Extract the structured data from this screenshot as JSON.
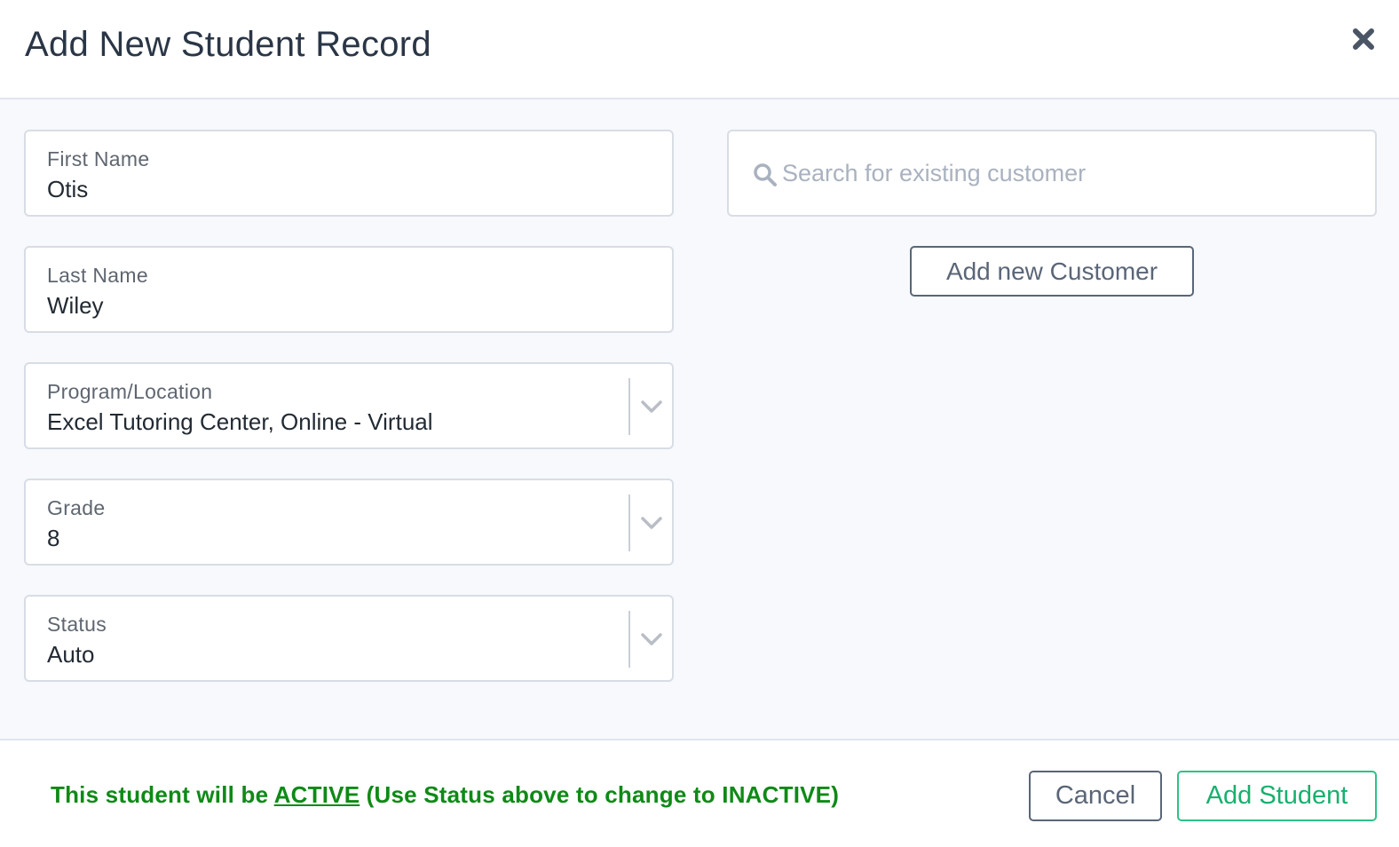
{
  "modal": {
    "title": "Add New Student Record",
    "close_icon": "close-icon"
  },
  "form": {
    "first_name": {
      "label": "First Name",
      "value": "Otis"
    },
    "last_name": {
      "label": "Last Name",
      "value": "Wiley"
    },
    "program_location": {
      "label": "Program/Location",
      "value": "Excel Tutoring Center, Online - Virtual"
    },
    "grade": {
      "label": "Grade",
      "value": "8"
    },
    "status": {
      "label": "Status",
      "value": "Auto"
    }
  },
  "customer": {
    "search_placeholder": "Search for existing customer",
    "search_icon": "search-icon",
    "add_button": "Add new Customer"
  },
  "footer": {
    "notice_prefix": "This student will be ",
    "notice_status": "ACTIVE",
    "notice_suffix": " (Use Status above to change to INACTIVE)",
    "cancel_label": "Cancel",
    "add_label": "Add Student"
  },
  "colors": {
    "notice_green": "#0e8a16",
    "primary_green": "#18b06e",
    "border": "#d8dde5",
    "background": "#f7f9fc"
  }
}
